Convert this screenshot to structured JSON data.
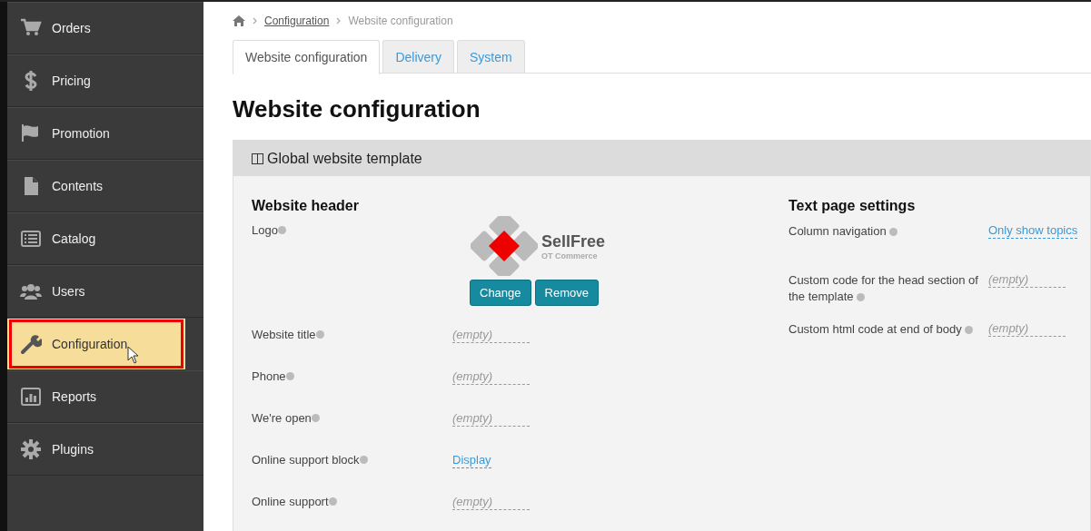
{
  "sidebar": {
    "items": [
      {
        "label": "Orders",
        "selected": false
      },
      {
        "label": "Pricing",
        "selected": false
      },
      {
        "label": "Promotion",
        "selected": false
      },
      {
        "label": "Contents",
        "selected": false
      },
      {
        "label": "Catalog",
        "selected": false
      },
      {
        "label": "Users",
        "selected": false
      },
      {
        "label": "Configuration",
        "selected": true
      },
      {
        "label": "Reports",
        "selected": false
      },
      {
        "label": "Plugins",
        "selected": false
      }
    ]
  },
  "breadcrumb": [
    {
      "label": "Configuration",
      "kind": "link"
    },
    {
      "label": "Website configuration",
      "kind": "current"
    }
  ],
  "tabs": [
    {
      "label": "Website configuration",
      "selected": true
    },
    {
      "label": "Delivery",
      "selected": false
    },
    {
      "label": "System",
      "selected": false
    }
  ],
  "page_title": "Website configuration",
  "panel": {
    "title": "Global website template",
    "left": {
      "heading": "Website header",
      "logo": {
        "label": "Logo",
        "brand": "SellFree",
        "tagline": "OT Commerce",
        "buttons": [
          "Change",
          "Remove"
        ]
      },
      "fields": [
        {
          "label": "Website title",
          "value": "(empty)",
          "kind": "empty"
        },
        {
          "label": "Phone",
          "value": "(empty)",
          "kind": "empty"
        },
        {
          "label": "We're open",
          "value": "(empty)",
          "kind": "empty"
        },
        {
          "label": "Online support block",
          "value": "Display",
          "kind": "link"
        },
        {
          "label": "Online support",
          "value": "(empty)",
          "kind": "empty"
        }
      ]
    },
    "right": {
      "heading": "Text page settings",
      "fields": [
        {
          "label": "Column navigation",
          "value": "Only show topics",
          "kind": "link"
        },
        {
          "label": "Custom code for the head section of the template",
          "value": "(empty)",
          "kind": "empty"
        },
        {
          "label": "Custom html code at end of body",
          "value": "(empty)",
          "kind": "empty"
        }
      ]
    }
  }
}
